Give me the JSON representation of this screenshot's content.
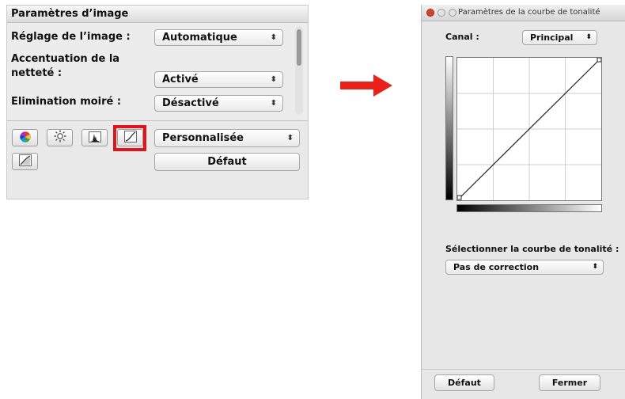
{
  "image_settings": {
    "title": "Paramètres d’image",
    "image_adjustment": {
      "label": "Réglage de l’image :",
      "value": "Automatique"
    },
    "sharpening": {
      "label_line1": "Accentuation de la",
      "label_line2": "netteté :",
      "value": "Activé"
    },
    "moire_reduction": {
      "label": "Elimination moiré :",
      "value": "Désactivé"
    },
    "toolbar": {
      "tools": [
        "color-balance-icon",
        "brightness-icon",
        "histogram-icon",
        "tone-curve-icon",
        "final-review-icon"
      ],
      "preset_value": "Personnalisée",
      "default_button": "Défaut",
      "highlight_color": "#e0141a"
    }
  },
  "arrow_color": "#e8211b",
  "tone_curve_dialog": {
    "title": "Paramètres de la courbe de tonalité",
    "channel_label": "Canal :",
    "channel_value": "Principal",
    "select_curve_label": "Sélectionner la courbe de tonalité :",
    "curve_value": "Pas de correction",
    "default_button": "Défaut",
    "close_button": "Fermer"
  }
}
